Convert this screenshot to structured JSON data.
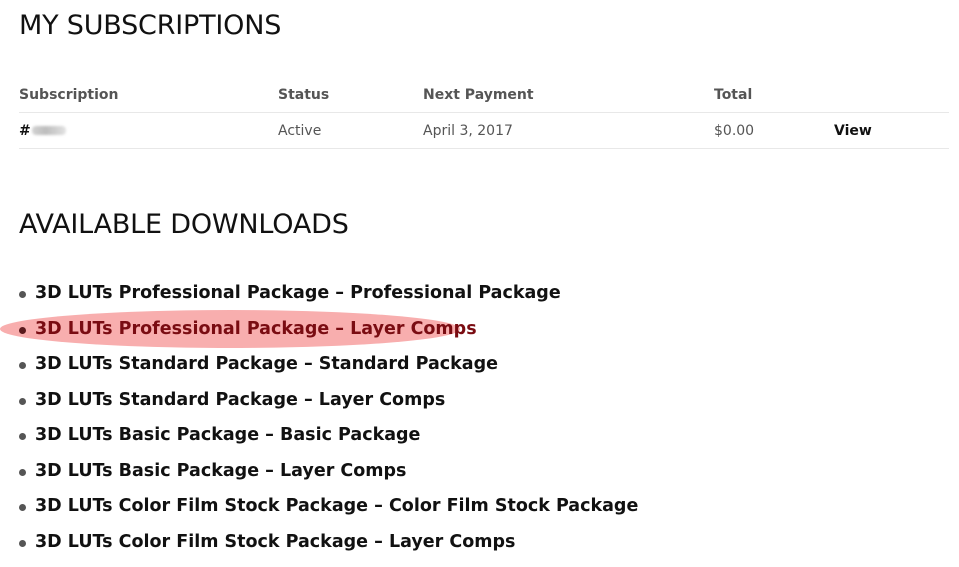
{
  "subscriptions": {
    "title": "MY SUBSCRIPTIONS",
    "columns": {
      "subscription": "Subscription",
      "status": "Status",
      "next_payment": "Next Payment",
      "total": "Total"
    },
    "rows": [
      {
        "number_prefix": "#",
        "status": "Active",
        "next_payment": "April 3, 2017",
        "total": "$0.00",
        "action": "View"
      }
    ]
  },
  "downloads": {
    "title": "AVAILABLE DOWNLOADS",
    "items": [
      {
        "label": "3D LUTs Professional Package – Professional Package"
      },
      {
        "label": "3D LUTs Professional Package – Layer Comps",
        "highlighted": true
      },
      {
        "label": "3D LUTs Standard Package – Standard Package"
      },
      {
        "label": "3D LUTs Standard Package – Layer Comps"
      },
      {
        "label": "3D LUTs Basic Package – Basic Package"
      },
      {
        "label": "3D LUTs Basic Package – Layer Comps"
      },
      {
        "label": "3D LUTs Color Film Stock Package – Color Film Stock Package"
      },
      {
        "label": "3D LUTs Color Film Stock Package – Layer Comps"
      }
    ]
  },
  "colors": {
    "highlight": "#f58282",
    "text": "#111111",
    "muted": "#555555",
    "divider": "#e8e8e8"
  }
}
